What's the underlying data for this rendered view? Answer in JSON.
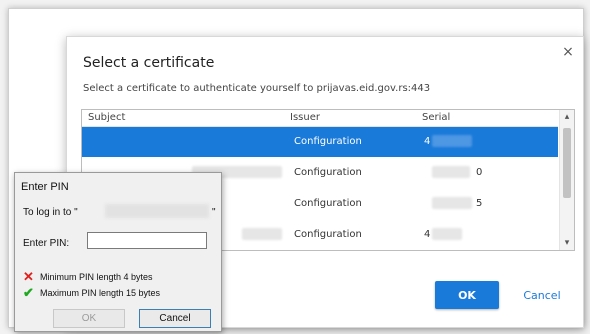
{
  "cert_dialog": {
    "title": "Select a certificate",
    "close_glyph": "×",
    "description": "Select a certificate to authenticate yourself to prijavas.eid.gov.rs:443",
    "columns": [
      "Subject",
      "Issuer",
      "Serial"
    ],
    "rows": [
      {
        "issuer": "Configuration",
        "serial": "4",
        "selected": true
      },
      {
        "issuer": "Configuration",
        "serial": "0",
        "selected": false
      },
      {
        "issuer": "Configuration",
        "serial": "5",
        "selected": false
      },
      {
        "issuer": "Configuration",
        "serial": "4",
        "selected": false
      }
    ],
    "ok_label": "OK",
    "cancel_label": "Cancel",
    "accent_color": "#1a7ad9"
  },
  "pin_dialog": {
    "title": "Enter PIN",
    "login_prefix": "To log in to \"",
    "login_suffix": "\"",
    "pin_label": "Enter PIN:",
    "pin_value": "",
    "rules": [
      {
        "icon": "cross-icon",
        "text": "Minimum PIN length 4 bytes",
        "status": "fail",
        "color": "#e0201c"
      },
      {
        "icon": "check-icon",
        "text": "Maximum PIN length 15 bytes",
        "status": "pass",
        "color": "#21a821"
      }
    ],
    "ok_label": "OK",
    "cancel_label": "Cancel"
  }
}
